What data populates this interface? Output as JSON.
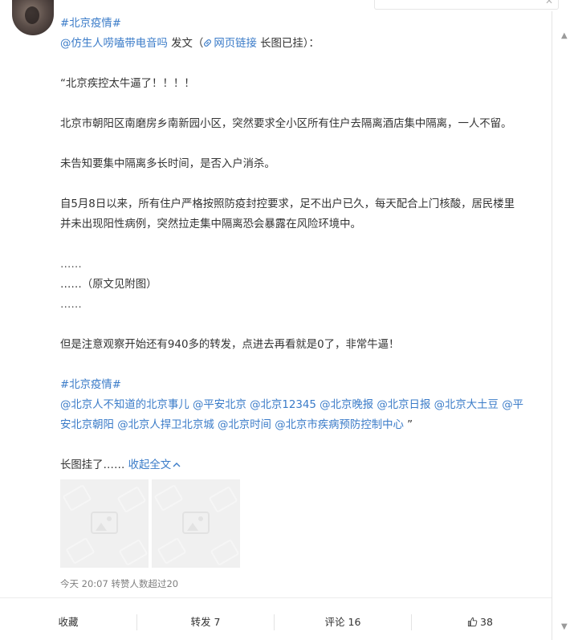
{
  "header": {
    "faded_username": "",
    "search_close_icon": "close-icon"
  },
  "post": {
    "hashtag_top": "#北京疫情#",
    "line_repost": {
      "user": "@仿生人唠嗑带电音吗",
      "mid": " 发文（",
      "link_icon": "link-icon",
      "link_text": "网页链接",
      "tail": " 长图已挂）："
    },
    "quote_title": "“北京疾控太牛逼了！！！！",
    "para1": "北京市朝阳区南磨房乡南新园小区，突然要求全小区所有住户去隔离酒店集中隔离，一人不留。",
    "para2": "未告知要集中隔离多长时间，是否入户消杀。",
    "para3_line1": "自5月8日以来，所有住户严格按照防疫封控要求，足不出户已久，每天配合上门核酸，居民楼里",
    "para3_line2": "并未出现阳性病例，突然拉走集中隔离恐会暴露在风险环境中。",
    "ellipsis1": "……",
    "ellipsis2": "……（原文见附图）",
    "ellipsis3": "……",
    "para4": "但是注意观察开始还有940多的转发，点进去再看就是0了，非常牛逼！",
    "hashtag_bottom": "#北京疫情#",
    "mentions_line1": "@北京人不知道的北京事儿 @平安北京 @北京12345 @北京晚报 @北京日报 @北京大土豆 @平",
    "mentions_line2": "安北京朝阳 @北京人捍卫北京城 @北京时间 @北京市疾病预防控制中心",
    "mentions_close_quote": " ”",
    "longimg_text": "长图挂了……",
    "collapse_link": " 收起全文",
    "collapse_icon": "chevron-up-icon",
    "meta": "今天 20:07 转赞人数超过20"
  },
  "actions": {
    "favorite": "收藏",
    "repost": "转发 7",
    "comment": "评论 16",
    "like_count": "38",
    "like_icon": "thumbs-up-icon"
  },
  "colors": {
    "link": "#3a7bc8",
    "text": "#333333",
    "meta": "#808080"
  }
}
